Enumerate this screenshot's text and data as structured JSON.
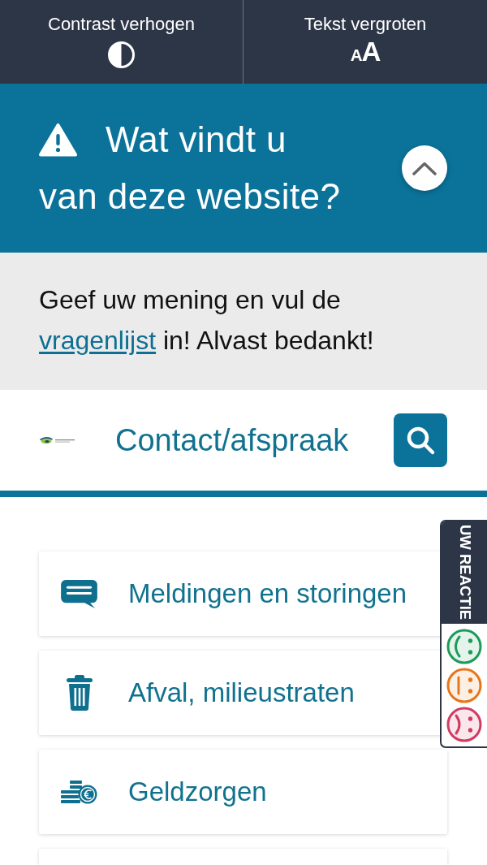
{
  "toolbar": [
    {
      "kind": "contrast",
      "label": "Contrast verhogen"
    },
    {
      "kind": "text-size",
      "label": "Tekst vergroten",
      "glyph": "AA"
    }
  ],
  "survey_banner": {
    "title_lines": [
      "Wat vindt u",
      "van deze website?"
    ],
    "expanded": true
  },
  "survey_body": {
    "text_before": "Geef uw mening en vul de",
    "link": "vragenlijst",
    "text_after": "in! Alvast bedankt!"
  },
  "header": {
    "nav_link": "Contact/afspraak"
  },
  "cards": [
    {
      "kind": "message",
      "label": "Meldingen en storingen"
    },
    {
      "kind": "waste",
      "label": "Afval, milieustraten"
    },
    {
      "kind": "money",
      "label": "Geldzorgen"
    }
  ],
  "feedback_tab": {
    "label": "UW REACTIE",
    "faces": [
      {
        "kind": "happy",
        "color": "#1e9a5b"
      },
      {
        "kind": "neutral",
        "color": "#e5761d"
      },
      {
        "kind": "sad",
        "color": "#d23b61"
      }
    ]
  }
}
